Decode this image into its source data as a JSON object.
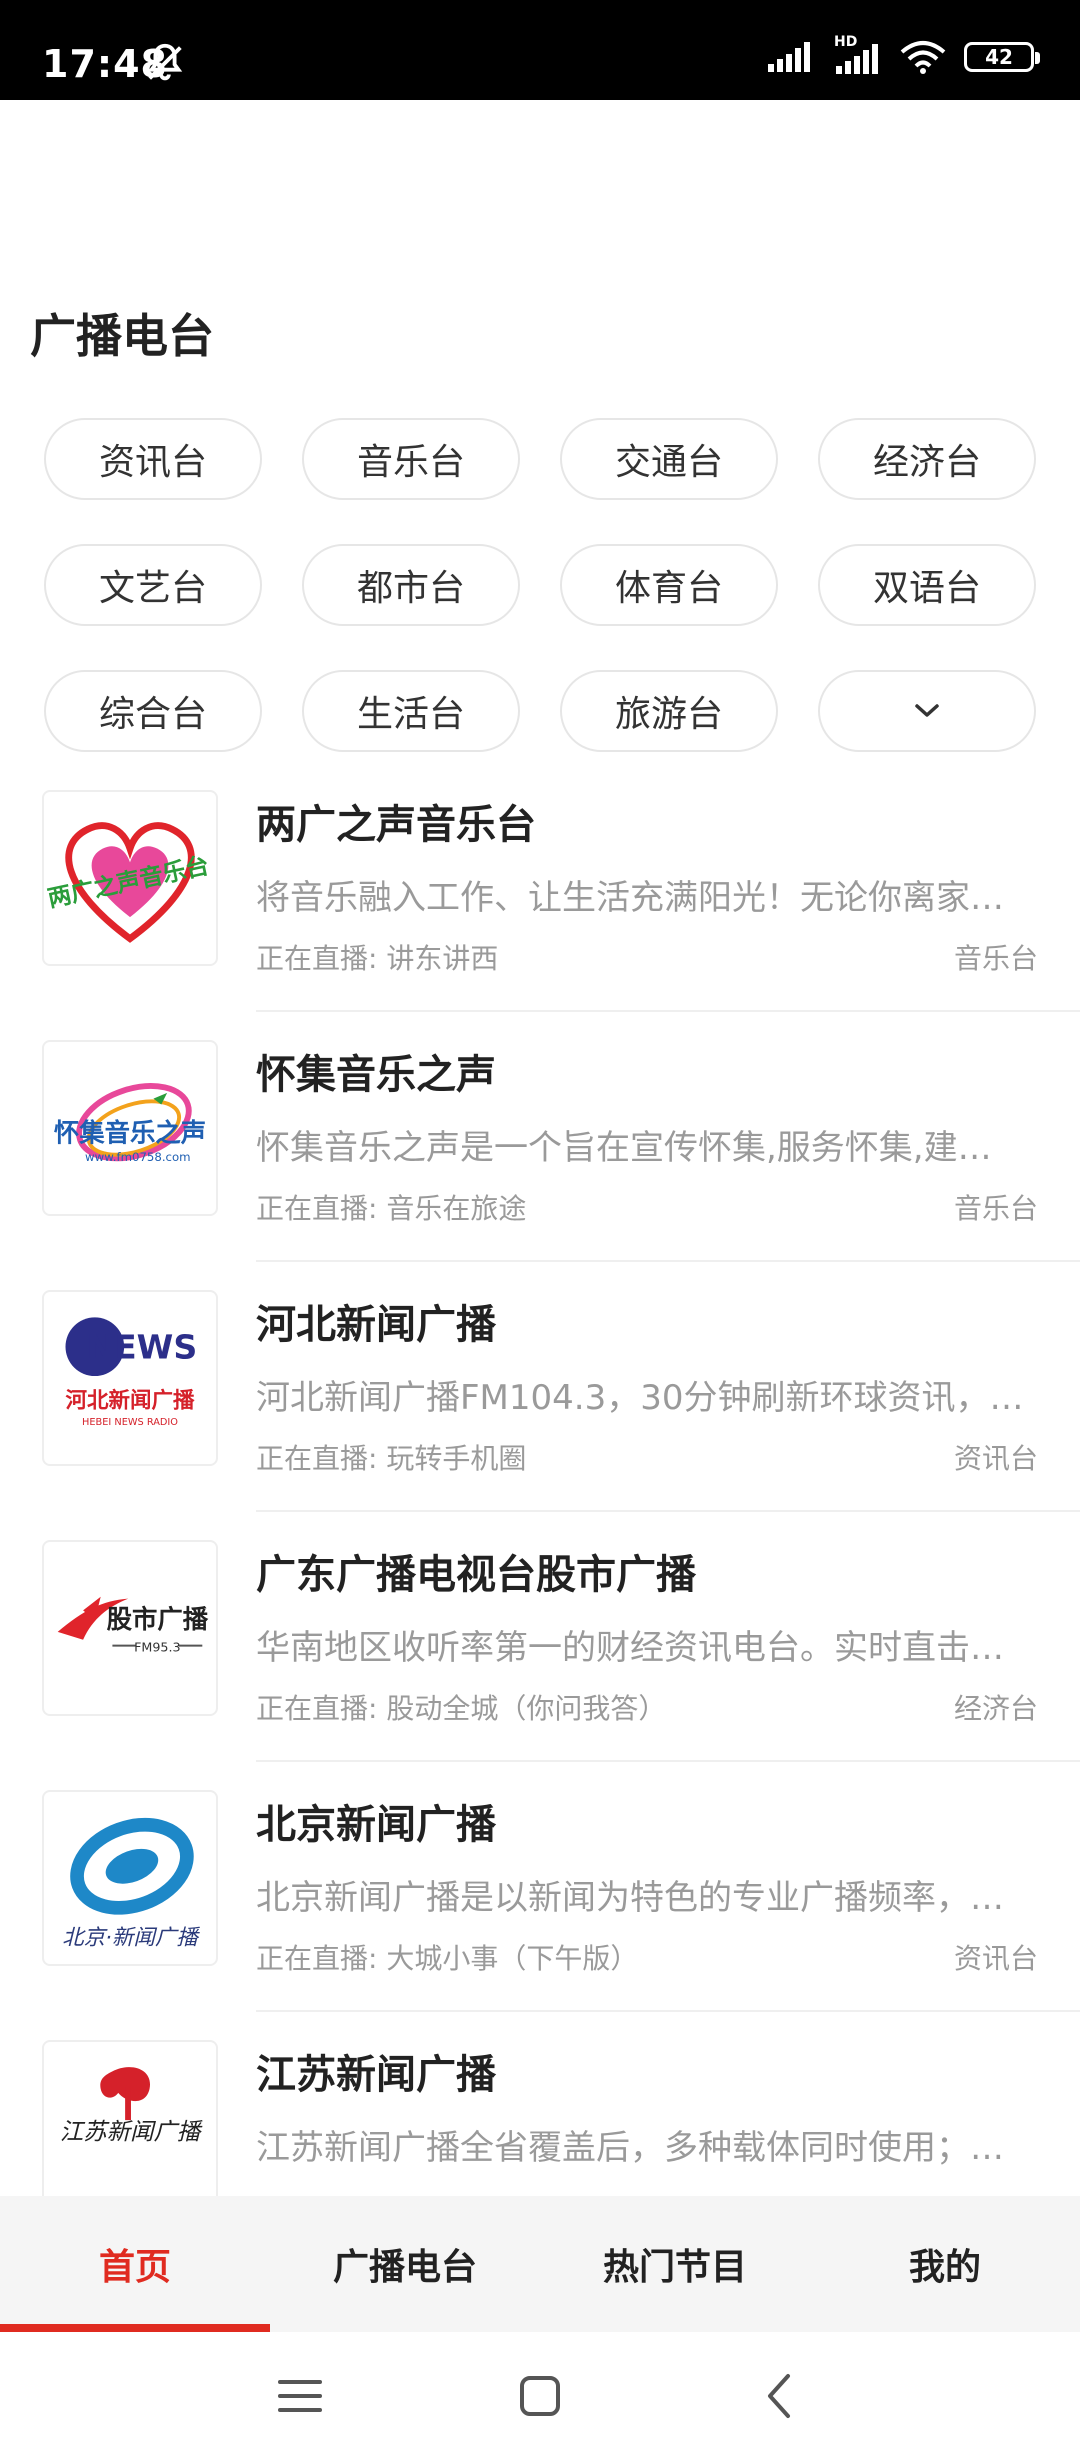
{
  "status": {
    "time": "17:48",
    "battery": "42",
    "network_badge": "HD"
  },
  "section_title": "广播电台",
  "categories": [
    "资讯台",
    "音乐台",
    "交通台",
    "经济台",
    "文艺台",
    "都市台",
    "体育台",
    "双语台",
    "综合台",
    "生活台",
    "旅游台"
  ],
  "stations": [
    {
      "title": "两广之声音乐台",
      "desc": "将音乐融入工作、让生活充满阳光！无论你离家…",
      "live": "正在直播: 讲东讲西",
      "category": "音乐台",
      "logo_text": "两广之声音乐台"
    },
    {
      "title": "怀集音乐之声",
      "desc": "怀集音乐之声是一个旨在宣传怀集,服务怀集,建…",
      "live": "正在直播: 音乐在旅途",
      "category": "音乐台",
      "logo_text": "怀集音乐之声",
      "logo_sub": "www.fm0758.com"
    },
    {
      "title": "河北新闻广播",
      "desc": "河北新闻广播FM104.3，30分钟刷新环球资讯，…",
      "live": "正在直播: 玩转手机圈",
      "category": "资讯台",
      "logo_text": "NEWS",
      "logo_sub": "河北新闻广播",
      "logo_sub2": "HEBEI NEWS RADIO"
    },
    {
      "title": "广东广播电视台股市广播",
      "desc": "华南地区收听率第一的财经资讯电台。实时直击…",
      "live": "正在直播: 股动全城（你问我答）",
      "category": "经济台",
      "logo_text": "股市广播",
      "logo_sub": "FM95.3"
    },
    {
      "title": "北京新闻广播",
      "desc": "北京新闻广播是以新闻为特色的专业广播频率，…",
      "live": "正在直播: 大城小事（下午版）",
      "category": "资讯台",
      "logo_text": "北京·新闻广播"
    },
    {
      "title": "江苏新闻广播",
      "desc": "江苏新闻广播全省覆盖后，多种载体同时使用；…",
      "live": "",
      "category": "",
      "logo_text": "江苏新闻广播"
    }
  ],
  "tabs": [
    "首页",
    "广播电台",
    "热门节目",
    "我的"
  ],
  "colors": {
    "accent": "#e02b20"
  }
}
